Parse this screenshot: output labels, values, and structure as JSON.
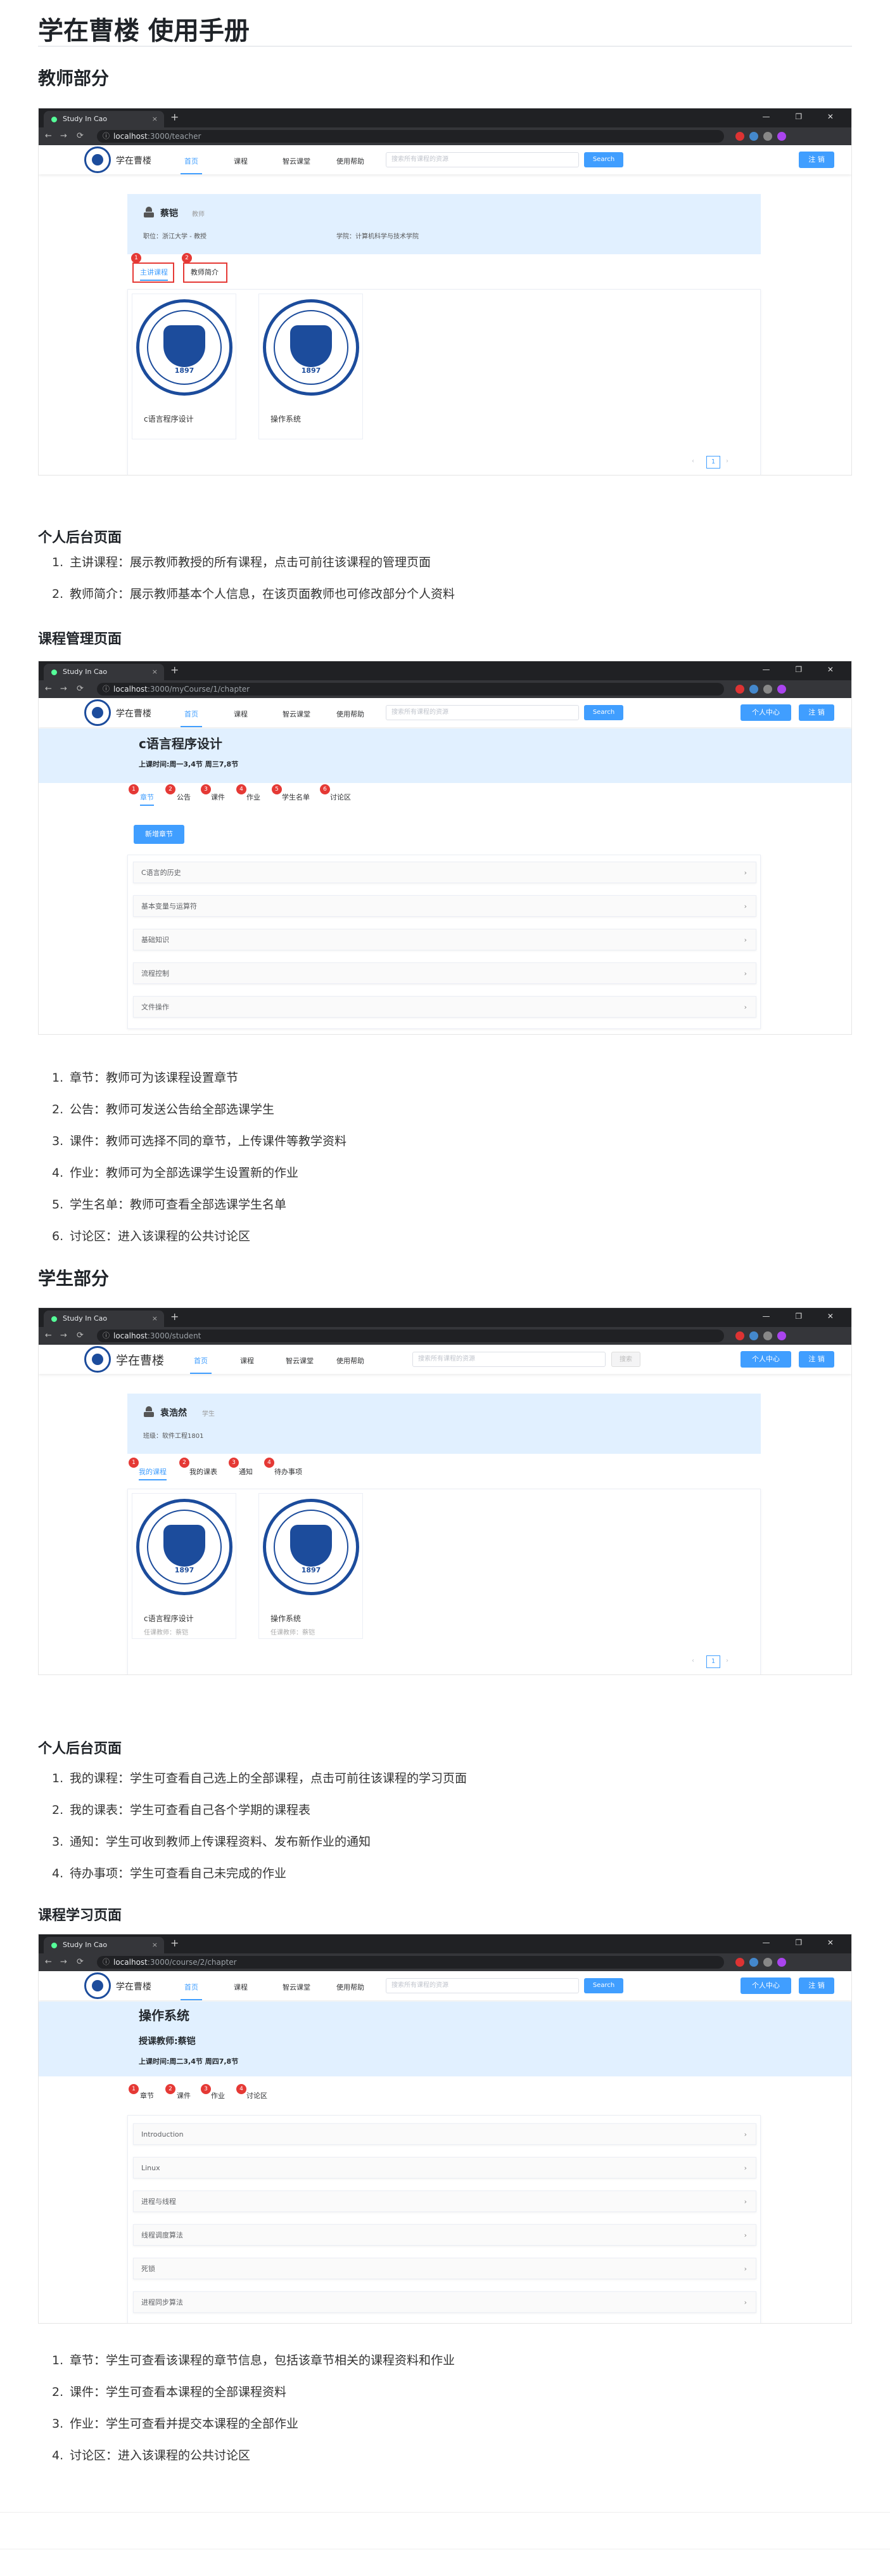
{
  "title": "学在曹楼 使用手册",
  "browser": {
    "tab_title": "Study In Cao",
    "new_tab": "+",
    "close": "×",
    "window_controls": "— ❐ ✕",
    "host": "localhost",
    "urls": [
      ":3000/teacher",
      ":3000/myCourse/1/chapter",
      ":3000/student",
      ":3000/course/2/chapter"
    ],
    "back": "←",
    "forward": "→",
    "reload": "⟳"
  },
  "app": {
    "brand": "学在曹楼",
    "nav": [
      "首页",
      "课程",
      "智云课堂",
      "使用帮助"
    ],
    "search_placeholder": "搜索所有课程的资源",
    "search_button": "Search",
    "personal_center": "个人中心",
    "logout": "注 销",
    "logo_year": "1897"
  },
  "sections": {
    "teacher": {
      "heading": "教师部分",
      "shot1": {
        "name": "蔡铠",
        "role": "教师",
        "unit_label": "职位：浙江大学 - 教授",
        "college": "学院：计算机科学与技术学院",
        "tabs": [
          "主讲课程",
          "教师简介"
        ],
        "courses": [
          "c语言程序设计",
          "操作系统"
        ],
        "pager": {
          "prev": "‹",
          "page": "1",
          "next": "›"
        }
      },
      "sub1": "个人后台页面",
      "list1": [
        "主讲课程：展示教师教授的所有课程，点击可前往该课程的管理页面",
        "教师简介：展示教师基本个人信息，在该页面教师也可修改部分个人资料"
      ],
      "sub2": "课程管理页面",
      "shot2": {
        "course": "c语言程序设计",
        "time": "上课时间:周一3,4节 周三7,8节",
        "tabs": [
          "章节",
          "公告",
          "课件",
          "作业",
          "学生名单",
          "讨论区"
        ],
        "add": "新增章节",
        "chapters": [
          "C语言的历史",
          "基本变量与运算符",
          "基础知识",
          "流程控制",
          "文件操作"
        ]
      },
      "list2": [
        "章节：教师可为该课程设置章节",
        "公告：教师可发送公告给全部选课学生",
        "课件：教师可选择不同的章节，上传课件等教学资料",
        "作业：教师可为全部选课学生设置新的作业",
        "学生名单：教师可查看全部选课学生名单",
        "讨论区：进入该课程的公共讨论区"
      ]
    },
    "student": {
      "heading": "学生部分",
      "shot3": {
        "name": "袁浩然",
        "role": "学生",
        "major": "班级：软件工程1801",
        "tabs": [
          "我的课程",
          "我的课表",
          "通知",
          "待办事项"
        ],
        "courses": [
          {
            "title": "c语言程序设计",
            "teacher": "任课教师：蔡铠"
          },
          {
            "title": "操作系统",
            "teacher": "任课教师：蔡铠"
          }
        ],
        "search_button": "搜索"
      },
      "sub1": "个人后台页面",
      "list1": [
        "我的课程：学生可查看自己选上的全部课程，点击可前往该课程的学习页面",
        "我的课表：学生可查看自己各个学期的课程表",
        "通知：学生可收到教师上传课程资料、发布新作业的通知",
        "待办事项：学生可查看自己未完成的作业"
      ],
      "sub2": "课程学习页面",
      "shot4": {
        "course": "操作系统",
        "teacher": "授课教师:蔡铠",
        "time": "上课时间:周二3,4节 周四7,8节",
        "tabs": [
          "章节",
          "课件",
          "作业",
          "讨论区"
        ],
        "chapters": [
          "Introduction",
          "Linux",
          "进程与线程",
          "线程调度算法",
          "死锁",
          "进程同步算法"
        ]
      },
      "list2": [
        "章节：学生可查看该课程的章节信息，包括该章节相关的课程资料和作业",
        "课件：学生可查看本课程的全部课程资料",
        "作业：学生可查看并提交本课程的全部作业",
        "讨论区：进入该课程的公共讨论区"
      ]
    }
  },
  "nums": [
    "1.",
    "2.",
    "3.",
    "4.",
    "5.",
    "6."
  ],
  "badge_nums": [
    "1",
    "2",
    "3",
    "4",
    "5",
    "6"
  ],
  "icons": {
    "arrow": "›",
    "lock": "ⓘ"
  }
}
